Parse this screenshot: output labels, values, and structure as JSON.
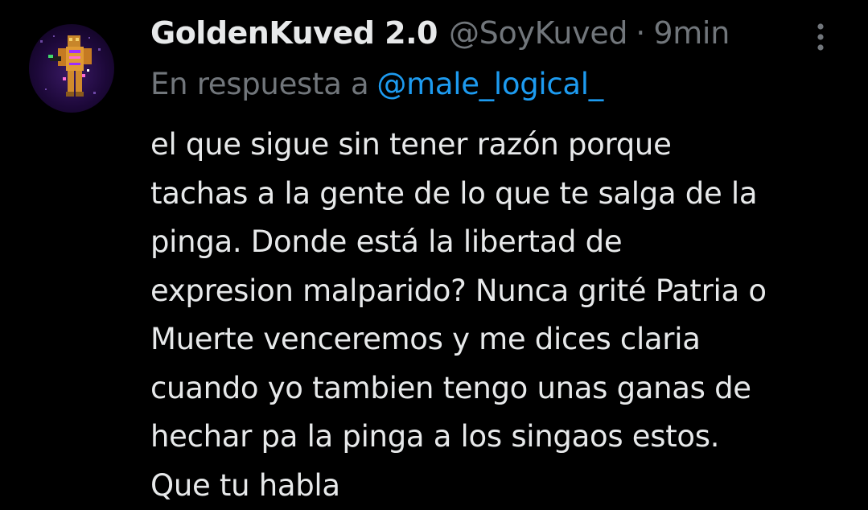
{
  "tweet": {
    "author": {
      "display_name": "GoldenKuved 2.0",
      "handle": "@SoyKuved",
      "avatar_icon": "pixel-character-avatar"
    },
    "separator": "·",
    "timestamp": "9min",
    "more_icon": "more-vertical-icon",
    "reply_to": {
      "prefix": "En respuesta a",
      "mention": "@male_logical_"
    },
    "body_lines": [
      "el que sigue sin tener razón porque",
      "tachas a la gente de lo que te salga de la",
      "pinga. Donde está la libertad de",
      "expresion malparido? Nunca grité Patria o",
      "Muerte venceremos y me dices claria",
      "cuando yo tambien tengo unas ganas de",
      "hechar pa la pinga a los singaos estos.",
      "Que tu habla"
    ]
  },
  "colors": {
    "background": "#000000",
    "primary_text": "#e7e9ea",
    "secondary_text": "#71767b",
    "link": "#1d9bf0"
  }
}
